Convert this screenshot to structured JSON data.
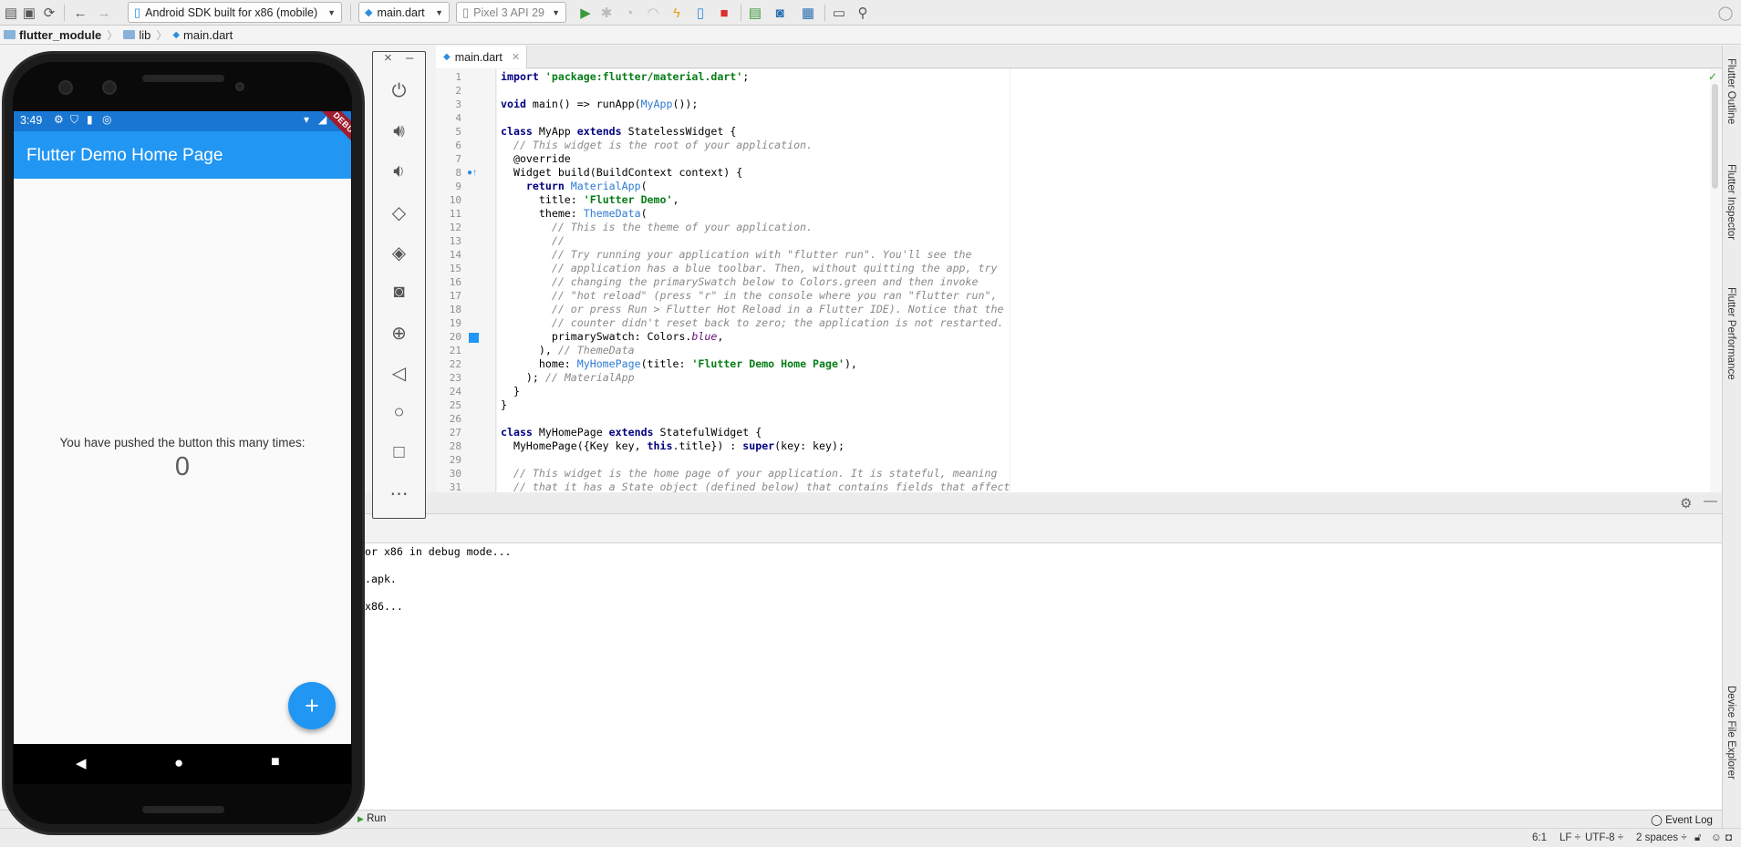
{
  "toolbar": {
    "device_selector": "Android SDK built for x86 (mobile)",
    "run_config": "main.dart",
    "avd_selector": "Pixel 3 API 29"
  },
  "breadcrumb": {
    "project": "flutter_module",
    "folder": "lib",
    "file": "main.dart"
  },
  "editor": {
    "tab_label": "main.dart",
    "line_numbers": [
      "1",
      "2",
      "3",
      "4",
      "5",
      "6",
      "7",
      "8",
      "9",
      "10",
      "11",
      "12",
      "13",
      "14",
      "15",
      "16",
      "17",
      "18",
      "19",
      "20",
      "21",
      "22",
      "23",
      "24",
      "25",
      "26",
      "27",
      "28",
      "29",
      "30",
      "31"
    ]
  },
  "code": {
    "l1_kw": "import",
    "l1_str": "'package:flutter/material.dart'",
    "l1_end": ";",
    "l3_kw": "void",
    "l3_mid": " main() => runApp(",
    "l3_typ": "MyApp",
    "l3_end": "());",
    "l5_kw1": "class",
    "l5_mid": " MyApp ",
    "l5_kw2": "extends",
    "l5_end": " StatelessWidget {",
    "l6_com": "  // This widget is the root of your application.",
    "l7": "  @override",
    "l8": "  Widget build(BuildContext context) {",
    "l9_kw": "    return",
    "l9_typ": " MaterialApp",
    "l9_end": "(",
    "l10_pre": "      title: ",
    "l10_str": "'Flutter Demo'",
    "l10_end": ",",
    "l11_pre": "      theme: ",
    "l11_typ": "ThemeData",
    "l11_end": "(",
    "l12_com": "        // This is the theme of your application.",
    "l13_com": "        //",
    "l14_com": "        // Try running your application with \"flutter run\". You'll see the",
    "l15_com": "        // application has a blue toolbar. Then, without quitting the app, try",
    "l16_com": "        // changing the primarySwatch below to Colors.green and then invoke",
    "l17_com": "        // \"hot reload\" (press \"r\" in the console where you ran \"flutter run\",",
    "l18_com": "        // or press Run > Flutter Hot Reload in a Flutter IDE). Notice that the",
    "l19_com": "        // counter didn't reset back to zero; the application is not restarted.",
    "l20_pre": "        primarySwatch: Colors.",
    "l20_it": "blue",
    "l20_end": ",",
    "l21_pre": "      ), ",
    "l21_com": "// ThemeData",
    "l22_pre": "      home: ",
    "l22_typ": "MyHomePage",
    "l22_mid": "(title: ",
    "l22_str": "'Flutter Demo Home Page'",
    "l22_end": "),",
    "l23_pre": "    ); ",
    "l23_com": "// MaterialApp",
    "l24": "  }",
    "l25": "}",
    "l27_kw1": "class",
    "l27_mid": " MyHomePage ",
    "l27_kw2": "extends",
    "l27_end": " StatefulWidget {",
    "l28_pre": "  MyHomePage({Key key, ",
    "l28_kw": "this",
    "l28_mid": ".title}) : ",
    "l28_kw2": "super",
    "l28_end": "(key: key);",
    "l30_com": "  // This widget is the home page of your application. It is stateful, meaning",
    "l31_com": "  // that it has a State object (defined below) that contains fields that affect"
  },
  "console": {
    "lines": [
      "or x86 in debug mode...",
      "",
      ".apk.",
      "",
      "x86..."
    ]
  },
  "bottom_tabs": {
    "run": "Run",
    "event_log": "Event Log"
  },
  "status": {
    "position": "6:1",
    "line_sep": "LF ÷",
    "encoding": "UTF-8 ÷",
    "indent": "2 spaces ÷"
  },
  "right_tabs": {
    "outline": "Flutter Outline",
    "inspector": "Flutter Inspector",
    "performance": "Flutter Performance",
    "device_explorer": "Device File Explorer"
  },
  "emulator": {
    "time": "3:49",
    "app_title": "Flutter Demo Home Page",
    "debug_banner": "DEBUG",
    "message": "You have pushed the button this many times:",
    "counter": "0",
    "fab_label": "+"
  },
  "colors": {
    "accent": "#2196f3",
    "status_bar": "#1976d2",
    "debug_ribbon": "#a01c2e"
  }
}
